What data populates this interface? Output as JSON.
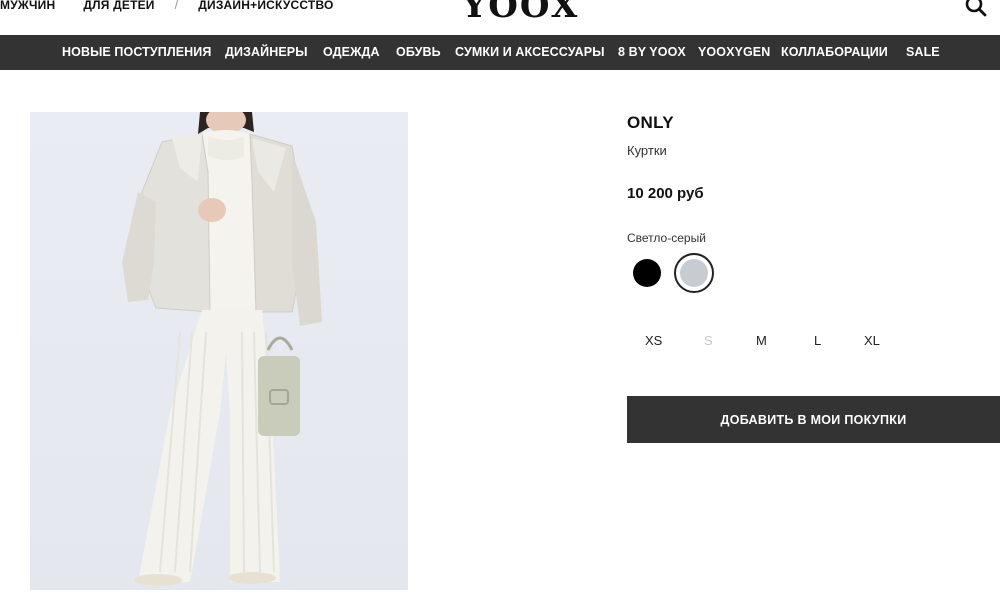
{
  "header": {
    "top_links": [
      "МУЖЧИН",
      "ДЛЯ ДЕТЕЙ",
      "ДИЗАЙН+ИСКУССТВО"
    ],
    "separator": "/",
    "logo": "YOOX"
  },
  "nav": {
    "items": [
      "НОВЫЕ ПОСТУПЛЕНИЯ",
      "ДИЗАЙНЕРЫ",
      "ОДЕЖДА",
      "ОБУВЬ",
      "СУМКИ И АКСЕССУАРЫ",
      "8 BY YOOX",
      "YOOXYGEN",
      "КОЛЛАБОРАЦИИ",
      "SALE"
    ]
  },
  "product": {
    "brand": "ONLY",
    "category": "Куртки",
    "price": "10 200 руб",
    "selected_color": "Светло-серый",
    "color_swatches": [
      {
        "name": "black",
        "hex": "#000000",
        "selected": false
      },
      {
        "name": "light-grey",
        "hex": "#c7ccd3",
        "selected": true
      }
    ],
    "sizes": [
      {
        "label": "XS",
        "available": true
      },
      {
        "label": "S",
        "available": false
      },
      {
        "label": "M",
        "available": true
      },
      {
        "label": "L",
        "available": true
      },
      {
        "label": "XL",
        "available": true
      }
    ],
    "add_button_label": "ДОБАВИТЬ В МОИ ПОКУПКИ"
  },
  "colors": {
    "nav_bg": "#333333",
    "button_bg": "#333333",
    "photo_bg": "#e7ebf1"
  }
}
